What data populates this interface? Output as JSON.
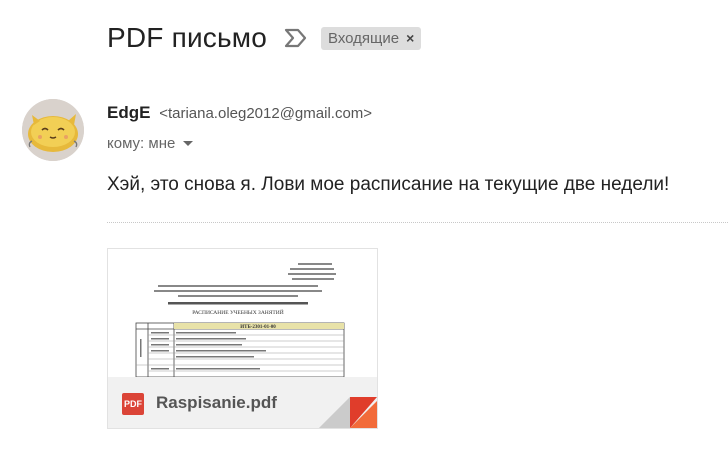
{
  "subject": {
    "title": "PDF письмо",
    "importance_icon": "importance-marker-icon",
    "label": "Входящие",
    "label_close": "×"
  },
  "sender": {
    "name": "EdgE",
    "email": "<tariana.oleg2012@gmail.com>",
    "recipient": "кому: мне",
    "avatar": "cat-avatar"
  },
  "message": {
    "body": "Хэй, это снова я. Лови мое расписание на текущие две недели!"
  },
  "attachment": {
    "filename": "Raspisanie.pdf",
    "type_badge": "PDF",
    "accent_color": "#db4437",
    "preview_heading": "РАСПИСАНИЕ УЧЕБНЫХ ЗАНЯТИЙ",
    "preview_group": "ИТБ-2301-01-00"
  }
}
